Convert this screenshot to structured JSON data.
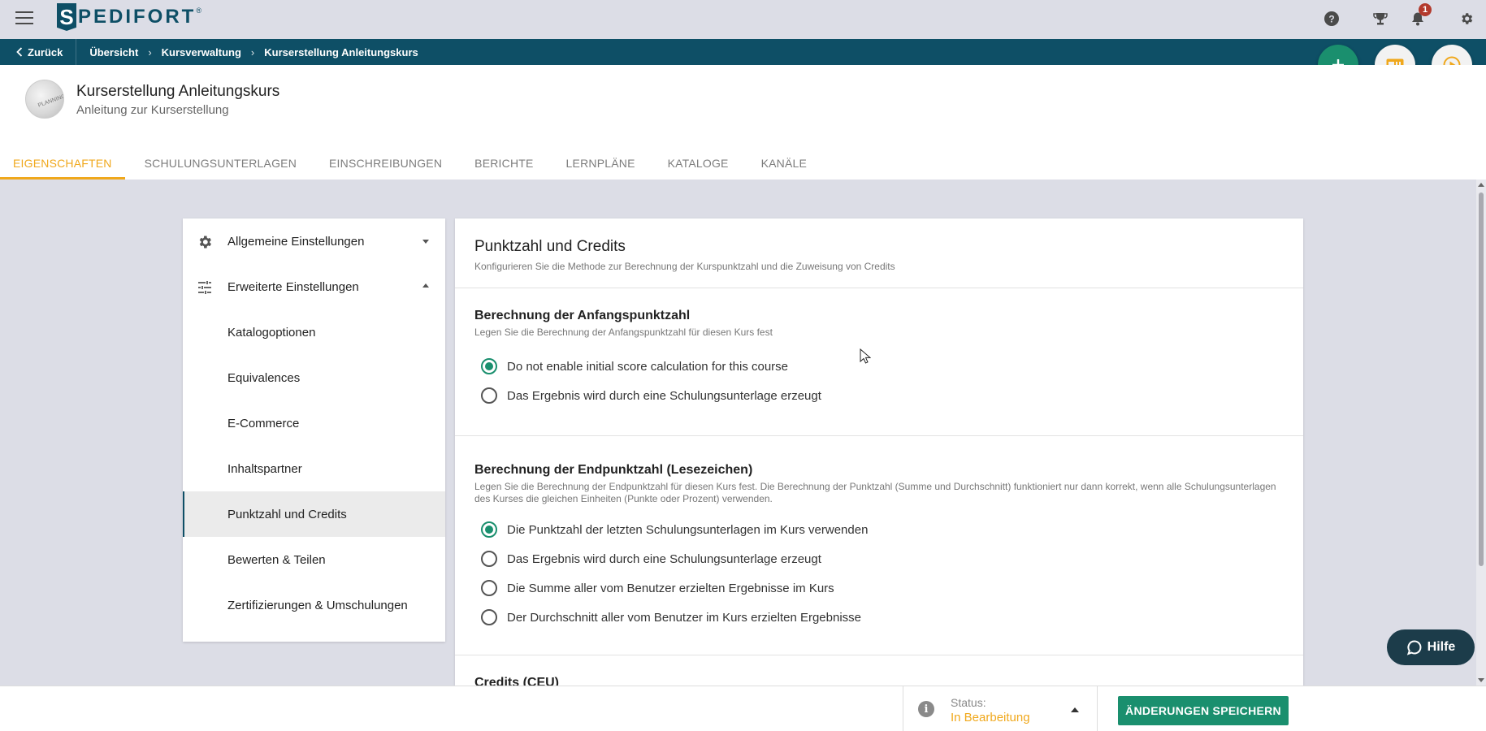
{
  "brand": {
    "name": "PEDIFORT",
    "initial": "S",
    "registered": "®"
  },
  "notifications": {
    "count": "1"
  },
  "breadcrumb": {
    "back_label": "Zurück",
    "items": [
      "Übersicht",
      "Kursverwaltung",
      "Kurserstellung Anleitungskurs"
    ]
  },
  "course": {
    "title": "Kurserstellung Anleitungskurs",
    "subtitle": "Anleitung zur Kurserstellung",
    "thumb_text": "PLANNING"
  },
  "tabs": [
    {
      "label": "EIGENSCHAFTEN",
      "active": true
    },
    {
      "label": "SCHULUNGSUNTERLAGEN"
    },
    {
      "label": "EINSCHREIBUNGEN"
    },
    {
      "label": "BERICHTE"
    },
    {
      "label": "LERNPLÄNE"
    },
    {
      "label": "KATALOGE"
    },
    {
      "label": "KANÄLE"
    }
  ],
  "sidebar": {
    "items": [
      {
        "label": "Allgemeine Einstellungen",
        "icon": "gear-icon"
      },
      {
        "label": "Erweiterte Einstellungen",
        "icon": "sliders-icon"
      },
      {
        "label": "Katalogoptionen"
      },
      {
        "label": "Equivalences"
      },
      {
        "label": "E-Commerce"
      },
      {
        "label": "Inhaltspartner"
      },
      {
        "label": "Punktzahl und Credits",
        "active": true
      },
      {
        "label": "Bewerten & Teilen"
      },
      {
        "label": "Zertifizierungen & Umschulungen"
      }
    ]
  },
  "main": {
    "title": "Punktzahl und Credits",
    "description": "Konfigurieren Sie die Methode zur Berechnung der Kurspunktzahl und die Zuweisung von Credits",
    "initial_score": {
      "title": "Berechnung der Anfangspunktzahl",
      "description": "Legen Sie die Berechnung der Anfangspunktzahl für diesen Kurs fest",
      "options": [
        "Do not enable initial score calculation for this course",
        "Das Ergebnis wird durch eine Schulungsunterlage erzeugt"
      ],
      "selected": 0
    },
    "final_score": {
      "title": "Berechnung der Endpunktzahl (Lesezeichen)",
      "description": "Legen Sie die Berechnung der Endpunktzahl für diesen Kurs fest. Die Berechnung der Punktzahl (Summe und Durchschnitt) funktioniert nur dann korrekt, wenn alle Schulungsunterlagen des Kurses die gleichen Einheiten (Punkte oder Prozent) verwenden.",
      "options": [
        "Die Punktzahl der letzten Schulungsunterlagen im Kurs verwenden",
        "Das Ergebnis wird durch eine Schulungsunterlage erzeugt",
        "Die Summe aller vom Benutzer erzielten Ergebnisse im Kurs",
        "Der Durchschnitt aller vom Benutzer im Kurs erzielten Ergebnisse"
      ],
      "selected": 0
    },
    "credits": {
      "title": "Credits (CEU)"
    }
  },
  "help": {
    "label": "Hilfe"
  },
  "footer": {
    "status_label": "Status:",
    "status_value": "In Bearbeitung",
    "save_label": "ÄNDERUNGEN SPEICHERN"
  },
  "colors": {
    "brand": "#0e4f66",
    "accent": "#f0a81c",
    "primary": "#1a8f6e",
    "background": "#dcdde6"
  }
}
